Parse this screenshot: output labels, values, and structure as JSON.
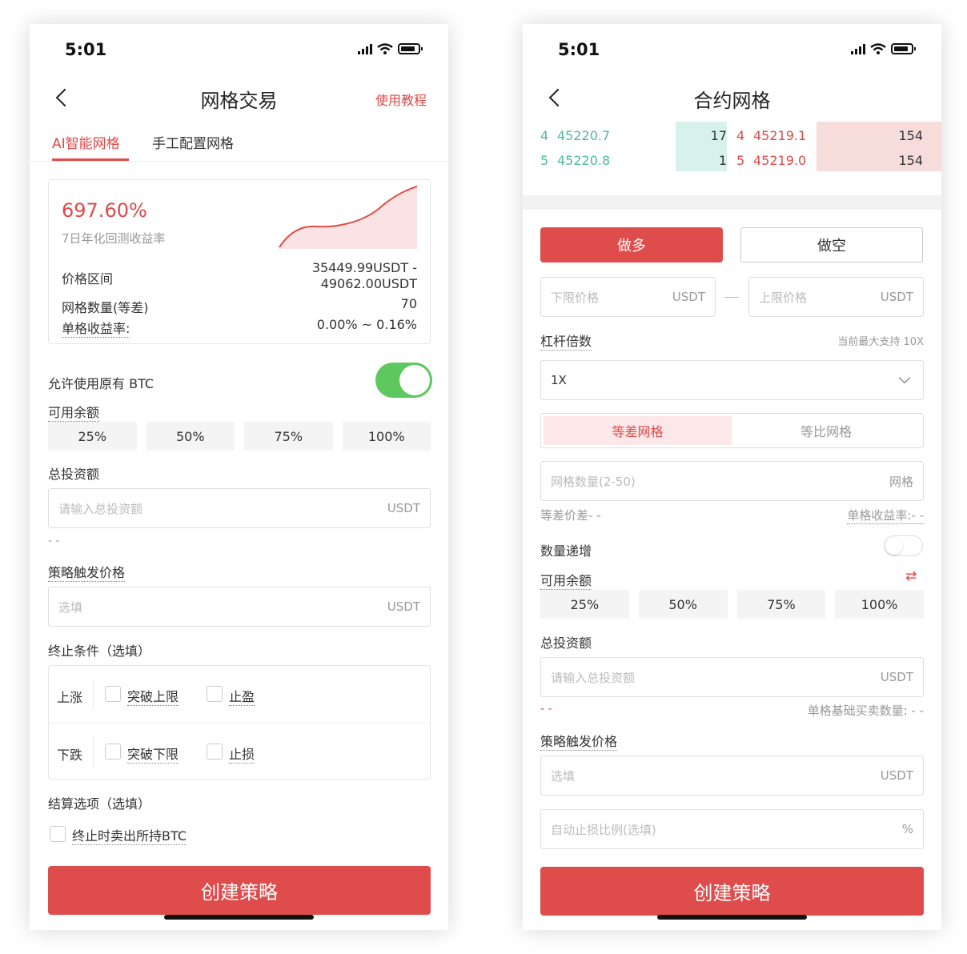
{
  "left": {
    "status_time": "5:01",
    "title": "网格交易",
    "tutorial": "使用教程",
    "tabs": [
      "AI智能网格",
      "手工配置网格"
    ],
    "summary": {
      "yield": "697.60%",
      "yield_label": "7日年化回测收益率",
      "price_range_label": "价格区间",
      "price_range_low": "35449.99USDT -",
      "price_range_high": "49062.00USDT",
      "grid_count_label": "网格数量(等差)",
      "grid_count": "70",
      "per_grid_label": "单格收益率:",
      "per_grid": "0.00% ~ 0.16%"
    },
    "allow_btc_label": "允许使用原有 BTC",
    "allow_btc_on": true,
    "available_label": "可用余额",
    "percents": [
      "25%",
      "50%",
      "75%",
      "100%"
    ],
    "total_invest_label": "总投资额",
    "total_invest_placeholder": "请输入总投资额",
    "unit": "USDT",
    "dashes": "- -",
    "trigger_label": "策略触发价格",
    "trigger_placeholder": "选填",
    "stop_label": "终止条件（选填）",
    "rise_label": "上涨",
    "break_upper": "突破上限",
    "take_profit": "止盈",
    "fall_label": "下跌",
    "break_lower": "突破下限",
    "stop_loss": "止损",
    "settle_label": "结算选项（选填）",
    "sell_btc": "终止时卖出所持BTC",
    "create": "创建策略"
  },
  "right": {
    "status_time": "5:01",
    "title": "合约网格",
    "orderbook": [
      {
        "bid_idx": "4",
        "bid_price": "45220.7",
        "bid_qty": "17",
        "ask_idx": "4",
        "ask_price": "45219.1",
        "ask_qty": "154"
      },
      {
        "bid_idx": "5",
        "bid_price": "45220.8",
        "bid_qty": "1",
        "ask_idx": "5",
        "ask_price": "45219.0",
        "ask_qty": "154"
      }
    ],
    "long": "做多",
    "short": "做空",
    "lower_price": "下限价格",
    "upper_price": "上限价格",
    "unit": "USDT",
    "leverage_label": "杠杆倍数",
    "leverage_max": "当前最大支持 10X",
    "leverage_value": "1X",
    "grid_type_arith": "等差网格",
    "grid_type_geo": "等比网格",
    "grid_count_placeholder": "网格数量(2-50)",
    "grid_unit": "网格",
    "diff_label": "等差价差- -",
    "per_grid_label": "单格收益率:- -",
    "qty_increase": "数量递增",
    "available_label": "可用余额",
    "percents": [
      "25%",
      "50%",
      "75%",
      "100%"
    ],
    "total_invest_label": "总投资额",
    "total_invest_placeholder": "请输入总投资额",
    "dashes": "- -",
    "base_qty": "单格基础买卖数量: - -",
    "trigger_label": "策略触发价格",
    "trigger_placeholder": "选填",
    "auto_stop_placeholder": "自动止损比例(选填)",
    "percent_unit": "%",
    "create": "创建策略"
  },
  "colors": {
    "accent_red": "#df4c4c",
    "toggle_green": "#5ec85e",
    "teal": "#4fb9a0"
  }
}
